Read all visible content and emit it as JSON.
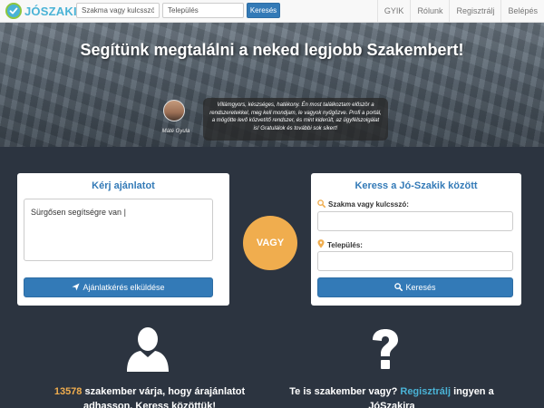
{
  "brand": {
    "name_part1": "JÓ",
    "name_part2": "SZAKI"
  },
  "nav": {
    "search_placeholder": "Szakma vagy kulcsszó",
    "location_placeholder": "Település",
    "search_button": "Keresés",
    "links": [
      "GYIK",
      "Rólunk",
      "Regisztrálj",
      "Belépés"
    ]
  },
  "hero": {
    "title": "Segítünk megtalálni a neked legjobb Szakembert!",
    "testimonial_name": "Máté Gyula",
    "testimonial_quote": "Villámgyors, készséges, hatékony. Én most találkoztam először a rendszeretekkel, meg kell mondjam, le vagyok nyűgözve. Profi a portál, a mögötte levő közvetítő rendszer, és mint kiderült, az ügyfélszolgálat is! Gratulálok és további sok sikert!",
    "carousel_slides": 4,
    "carousel_active": 1
  },
  "offer_panel": {
    "title": "Kérj ajánlatot",
    "textarea_value": "Sürgősen segítségre van |",
    "button": "Ajánlatkérés elküldése"
  },
  "divider": {
    "label": "VAGY"
  },
  "search_panel": {
    "title": "Keress a Jó-Szakik között",
    "keyword_label": "Szakma vagy kulcsszó:",
    "location_label": "Település:",
    "button": "Keresés"
  },
  "stats": {
    "count": "13578",
    "left_text_rest": "szakember várja, hogy árajánlatot",
    "left_text_line2": "adhasson. Keress közöttük!",
    "right_text_prefix": "Te is szakember vagy?",
    "right_link": "Regisztrálj",
    "right_text_suffix": "ingyen a",
    "right_text_line2": "JóSzakira"
  },
  "colors": {
    "primary": "#337ab7",
    "accent": "#f0ad4e",
    "brand": "#4ab3d6",
    "dark_bg": "#2c3440"
  }
}
